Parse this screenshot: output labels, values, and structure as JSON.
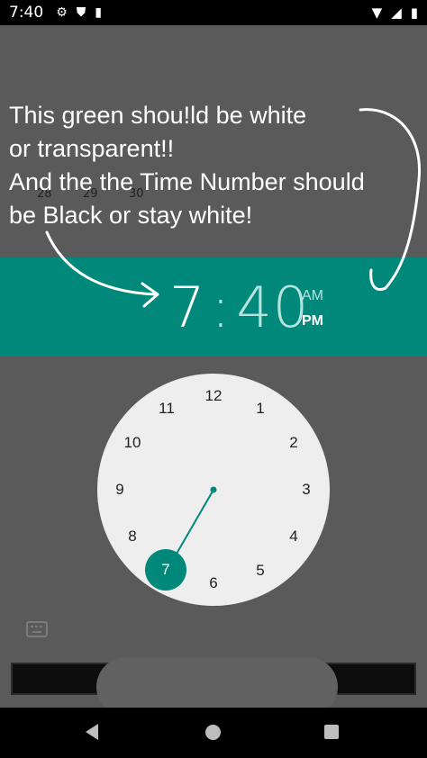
{
  "status_bar": {
    "time": "7:40",
    "icons": [
      "gear-icon",
      "shield-icon",
      "sd-card-icon",
      "wifi-icon",
      "signal-icon",
      "battery-icon"
    ]
  },
  "annotation": {
    "text": "This green shou!ld be white\nor transparent!!\nAnd the the Time Number should\nbe Black or stay white!"
  },
  "calendar_days": [
    "28",
    "29",
    "30"
  ],
  "time_picker": {
    "header_color": "#00897b",
    "hour": "7",
    "separator": ":",
    "minute": "40",
    "am_label": "AM",
    "pm_label": "PM",
    "selected_period": "PM",
    "clock_numbers": [
      "12",
      "1",
      "2",
      "3",
      "4",
      "5",
      "6",
      "7",
      "8",
      "9",
      "10",
      "11"
    ],
    "selected_number": "7"
  },
  "nav_bar": {
    "icons": [
      "back-icon",
      "home-icon",
      "recents-icon"
    ]
  }
}
